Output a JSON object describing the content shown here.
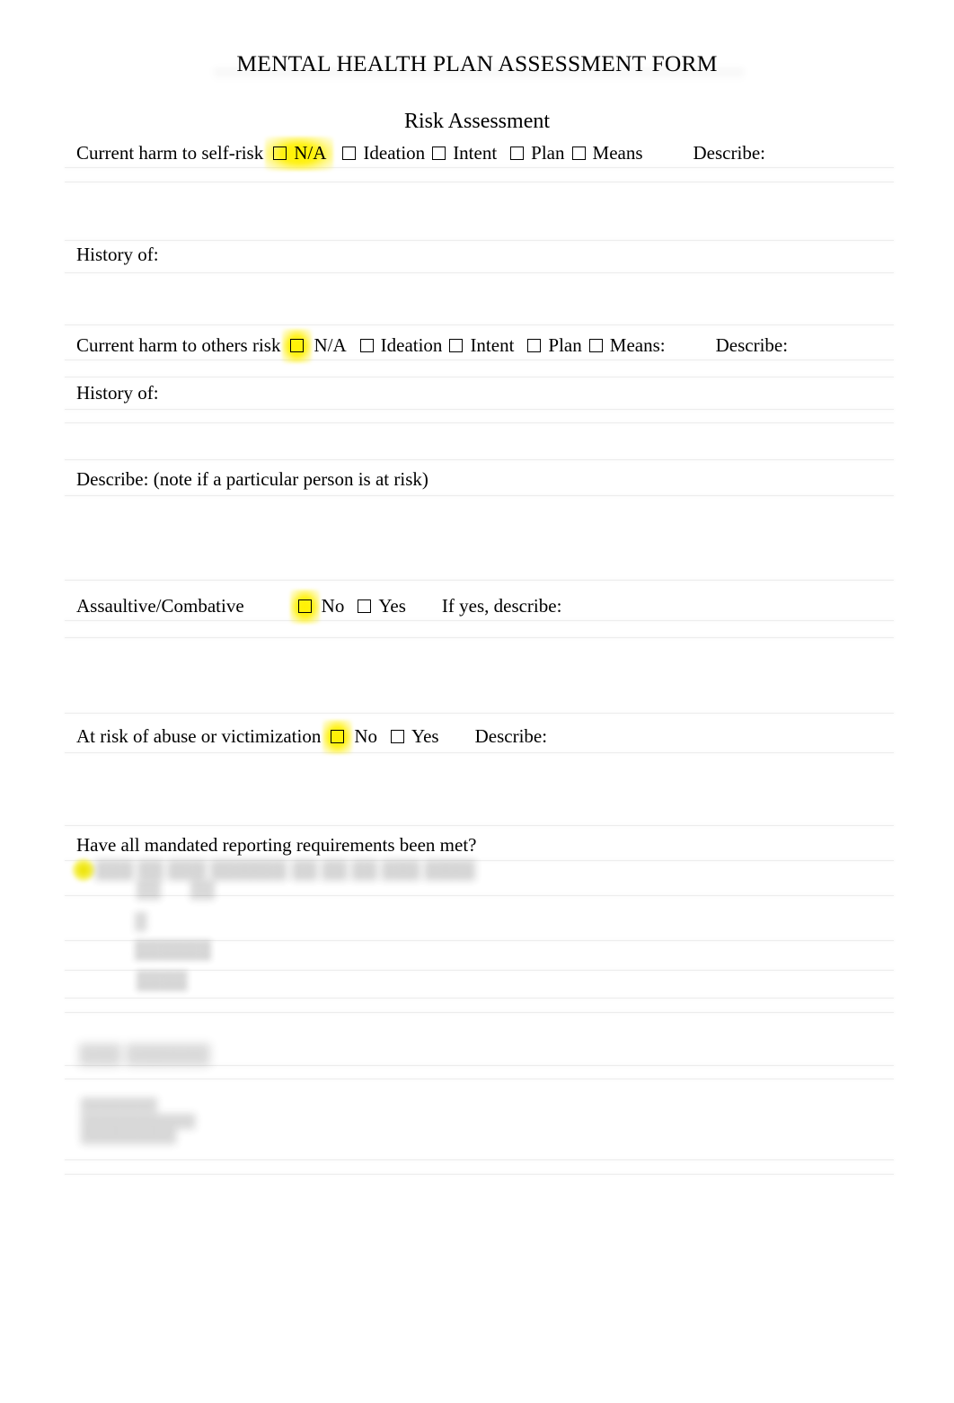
{
  "document": {
    "title": "MENTAL HEALTH PLAN ASSESSMENT FORM",
    "section_heading": "Risk Assessment"
  },
  "rows": {
    "harm_self": {
      "label": "Current harm to self-risk",
      "options": [
        "N/A",
        "Ideation",
        "Intent",
        "Plan",
        "Means"
      ],
      "describe_label": "Describe:",
      "highlighted_option": "N/A",
      "highlight_includes_label": true
    },
    "history_self": {
      "label": "History of:"
    },
    "harm_others": {
      "label": "Current harm to others risk",
      "options": [
        "N/A",
        "Ideation",
        "Intent",
        "Plan",
        "Means:"
      ],
      "describe_label": "Describe:",
      "highlighted_option": "N/A",
      "highlight_includes_label": false
    },
    "history_others": {
      "label": "History of:"
    },
    "describe_others": {
      "label": "Describe: (note if a particular person is at risk)"
    },
    "assaultive": {
      "label": "Assaultive/Combative",
      "options": [
        "No",
        "Yes"
      ],
      "describe_label": "If yes, describe:",
      "highlighted_option": "No",
      "highlight_includes_label": false
    },
    "abuse_risk": {
      "label": "At risk of abuse or victimization",
      "options": [
        "No",
        "Yes"
      ],
      "describe_label": "Describe:",
      "highlighted_option": "No",
      "highlight_includes_label": false
    },
    "mandated_reporting": {
      "label": "Have all mandated reporting requirements been met?"
    }
  },
  "redacted": {
    "note": "illegible",
    "mandated_line_1": "▒▒▒ ▒▒ ▒▒▒ ▒▒▒▒▒▒",
    "mandated_line_2": "▒▒ ▒▒ ▒▒ ▒▒▒ ▒▒▒▒",
    "mandated_sub_a": "▒▒",
    "mandated_sub_b": "▒▒",
    "mandated_sub_c": "▒",
    "mandated_sub_d": "▒▒▒▒▒▒",
    "mandated_sub_e": "▒▒▒▒",
    "closing_heading": "▒▒▒ ▒▒▒▒▒▒",
    "closing_block": "▒▒▒▒▒▒▒▒\n▒▒▒▒▒▒▒▒▒▒▒▒\n▒▒▒▒▒▒▒▒▒▒"
  },
  "colors": {
    "highlight": "#fff200",
    "rule": "#ededed",
    "text": "#000000"
  }
}
